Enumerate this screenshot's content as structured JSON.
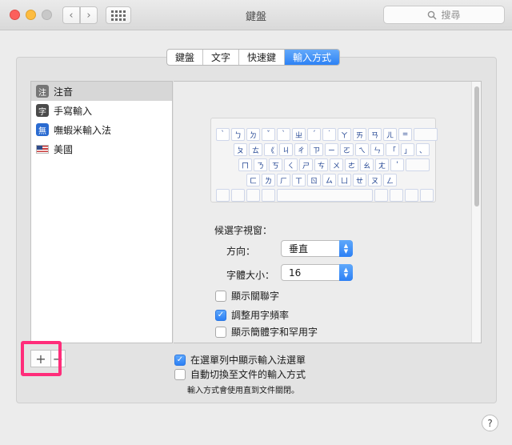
{
  "window": {
    "title": "鍵盤"
  },
  "toolbar": {
    "back": "‹",
    "forward": "›",
    "search_placeholder": "搜尋"
  },
  "tabs": [
    {
      "label": "鍵盤",
      "active": false
    },
    {
      "label": "文字",
      "active": false
    },
    {
      "label": "快速鍵",
      "active": false
    },
    {
      "label": "輸入方式",
      "active": true
    }
  ],
  "input_sources": [
    {
      "badge": "注",
      "label": "注音",
      "selected": true
    },
    {
      "badge": "字",
      "label": "手寫輸入",
      "selected": false
    },
    {
      "badge": "無",
      "label": "嘸蝦米輸入法",
      "selected": false
    },
    {
      "badge": "",
      "label": "美國",
      "selected": false
    }
  ],
  "keyboard": {
    "row1": [
      "`",
      "ㄅ",
      "ㄉ",
      "ˇ",
      "ˋ",
      "ㄓ",
      "ˊ",
      "˙",
      "ㄚ",
      "ㄞ",
      "ㄢ",
      "ㄦ",
      "="
    ],
    "row2": [
      "ㄆ",
      "ㄊ",
      "《",
      "ㄐ",
      "ㄔ",
      "ㄗ",
      "ㄧ",
      "ㄛ",
      "ㄟ",
      "ㄣ",
      "「",
      "」",
      "、"
    ],
    "row3": [
      "ㄇ",
      "ㄋ",
      "ㄎ",
      "ㄑ",
      "ㄕ",
      "ㄘ",
      "ㄨ",
      "ㄜ",
      "ㄠ",
      "ㄤ",
      "'"
    ],
    "row4": [
      "ㄈ",
      "ㄌ",
      "ㄏ",
      "ㄒ",
      "ㄖ",
      "ㄙ",
      "ㄩ",
      "ㄝ",
      "ㄡ",
      "ㄥ"
    ]
  },
  "options": {
    "candidate_window_label": "候選字視窗：",
    "direction_label": "方向：",
    "direction_value": "垂直",
    "font_size_label": "字體大小：",
    "font_size_value": "16",
    "checkboxes": [
      {
        "label": "顯示關聯字",
        "checked": false
      },
      {
        "label": "調整用字頻率",
        "checked": true
      },
      {
        "label": "顯示簡體字和罕用字",
        "checked": false
      }
    ]
  },
  "bottom": {
    "add": "+",
    "remove": "−",
    "show_in_menu_label": "在選單列中顯示輸入法選單",
    "show_in_menu_checked": true,
    "auto_switch_label": "自動切換至文件的輸入方式",
    "auto_switch_checked": false,
    "note": "輸入方式會使用直到文件關閉。",
    "help": "?"
  }
}
